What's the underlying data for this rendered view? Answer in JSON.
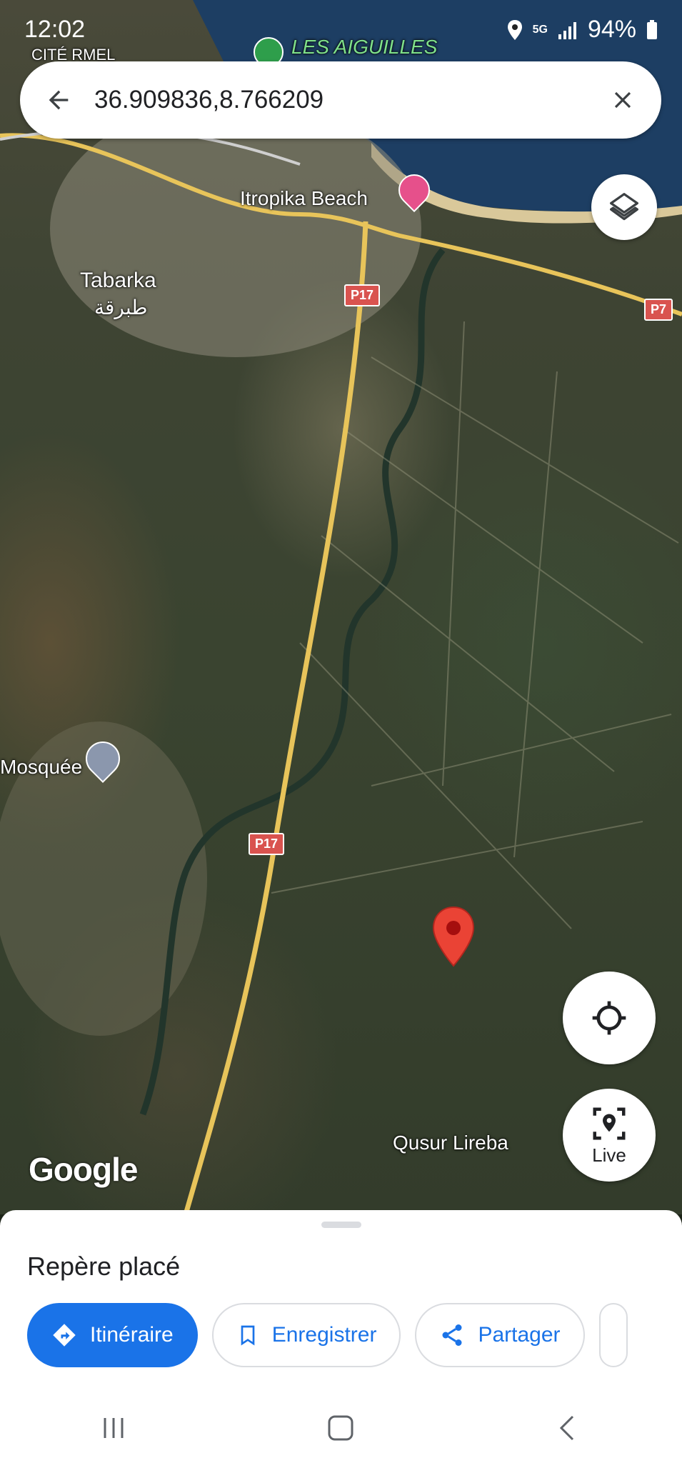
{
  "status_bar": {
    "time": "12:02",
    "network": "5G",
    "battery": "94%"
  },
  "search": {
    "query": "36.909836,8.766209"
  },
  "map": {
    "labels": {
      "les_aiguilles": "LES AIGUILLES",
      "cite_rmel": "CITÉ RMEL",
      "itropika_beach": "Itropika Beach",
      "tabarka": "Tabarka",
      "tabarka_ar": "طبرقة",
      "mosquee": "Mosquée",
      "qusur_lireba": "Qusur Lireba"
    },
    "road_shields": {
      "p17_top": "P17",
      "p7": "P7",
      "p17_bottom": "P17"
    },
    "google_logo": "Google"
  },
  "live_button": {
    "label": "Live"
  },
  "sheet": {
    "title": "Repère placé",
    "chips": {
      "directions": "Itinéraire",
      "save": "Enregistrer",
      "share": "Partager"
    }
  },
  "colors": {
    "accent": "#1a73e8",
    "pin": "#ea4335"
  }
}
